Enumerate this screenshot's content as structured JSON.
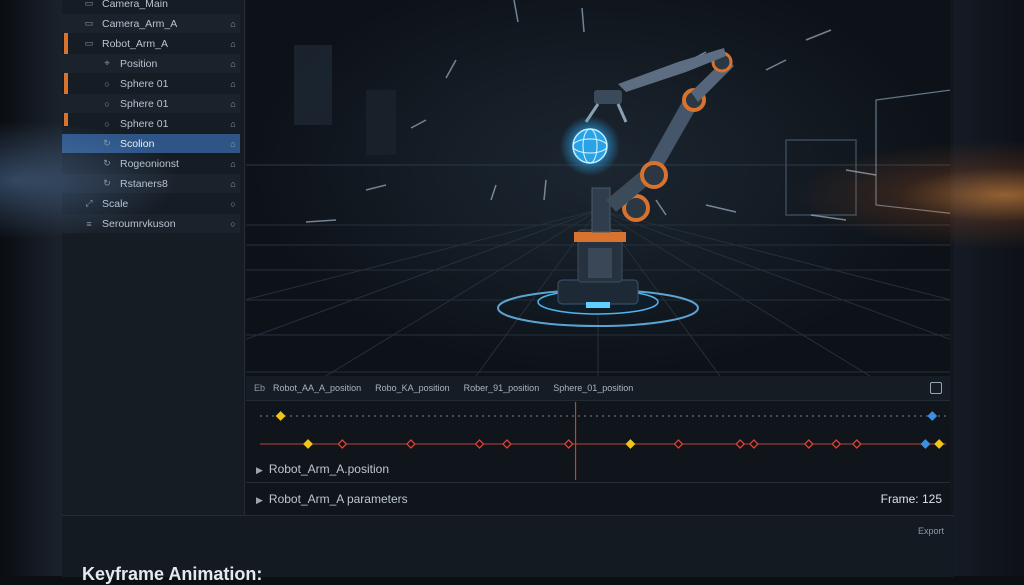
{
  "outliner": {
    "items": [
      {
        "label": "Camera_Main",
        "icon": "camera-icon",
        "lock": ""
      },
      {
        "label": "Camera_Arm_A",
        "icon": "camera-icon",
        "lock": "⌂"
      },
      {
        "label": "Robot_Arm_A",
        "icon": "object-icon",
        "lock": "⌂"
      },
      {
        "label": "Position",
        "icon": "position-icon",
        "lock": "⌂"
      },
      {
        "label": "Sphere 01",
        "icon": "sphere-icon",
        "lock": "⌂"
      },
      {
        "label": "Sphere 01",
        "icon": "sphere-icon",
        "lock": "⌂"
      },
      {
        "label": "Sphere 01",
        "icon": "sphere-icon",
        "lock": "⌂"
      },
      {
        "label": "Scolion",
        "icon": "rotation-icon",
        "lock": "⌂"
      },
      {
        "label": "Rogeonionst",
        "icon": "rotation-icon",
        "lock": "⌂"
      },
      {
        "label": "Rstaners8",
        "icon": "rotation-icon",
        "lock": "⌂"
      },
      {
        "label": "Scale",
        "icon": "scale-icon",
        "lock": "○"
      },
      {
        "label": "Seroumrvkuson",
        "icon": "list-icon",
        "lock": "○"
      }
    ]
  },
  "timeline": {
    "header": {
      "eb": "Eb",
      "channels": [
        "Robot_AA_A_position",
        "Robo_KA_position",
        "Rober_91_position",
        "Sphere_01_position"
      ]
    },
    "tracks": [
      "Robot_Arm_A.position",
      "Robot_Arm_A parameters"
    ],
    "frame_label": "Frame: 125",
    "playhead_fraction": 0.46,
    "keyframes_row1": [
      {
        "pos": 0.03,
        "color": "#f0c419"
      },
      {
        "pos": 0.98,
        "color": "#3d8fe0"
      }
    ],
    "keyframes_row2": [
      {
        "pos": 0.07,
        "color": "#f0c419"
      },
      {
        "pos": 0.12,
        "color": "#d9423a"
      },
      {
        "pos": 0.22,
        "color": "#d9423a"
      },
      {
        "pos": 0.32,
        "color": "#d9423a"
      },
      {
        "pos": 0.36,
        "color": "#d9423a"
      },
      {
        "pos": 0.45,
        "color": "#d9423a"
      },
      {
        "pos": 0.54,
        "color": "#f0c419"
      },
      {
        "pos": 0.61,
        "color": "#d9423a"
      },
      {
        "pos": 0.7,
        "color": "#d9423a"
      },
      {
        "pos": 0.72,
        "color": "#d9423a"
      },
      {
        "pos": 0.8,
        "color": "#d9423a"
      },
      {
        "pos": 0.84,
        "color": "#d9423a"
      },
      {
        "pos": 0.87,
        "color": "#d9423a"
      },
      {
        "pos": 0.97,
        "color": "#3d8fe0"
      },
      {
        "pos": 0.99,
        "color": "#f0c419"
      }
    ]
  },
  "footer": {
    "export": "Export",
    "caption": "Keyframe Animation:"
  },
  "colors": {
    "accent": "#d7732f",
    "selection": "#2f5587",
    "hologram": "#4fc3ff"
  }
}
